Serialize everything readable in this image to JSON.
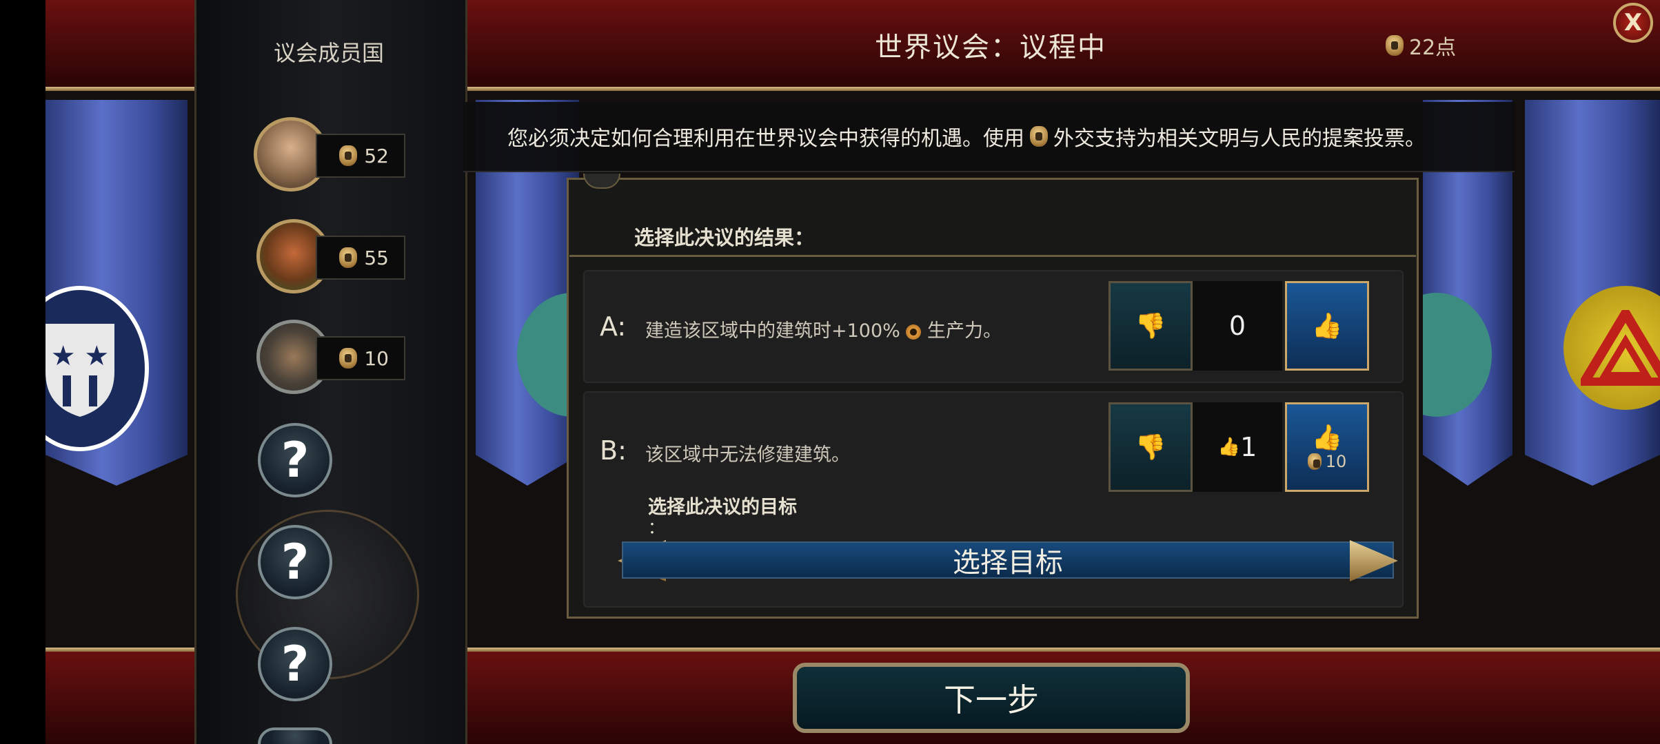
{
  "header": {
    "title": "世界议会：议程中",
    "points": "22点",
    "close_label": "X"
  },
  "instruction": {
    "prefix": "您必须决定如何合理利用在世界议会中获得的机遇。使用",
    "suffix": "外交支持为相关文明与人民的提案投票。"
  },
  "sidebar": {
    "title": "议会成员国",
    "members": [
      {
        "votes": "52"
      },
      {
        "votes": "55"
      },
      {
        "votes": "10"
      }
    ],
    "unknown_label": "?"
  },
  "resolution": {
    "outcome_heading": "选择此决议的结果：",
    "options": [
      {
        "letter": "A:",
        "text_before": "建造该区域中的建筑时+100%",
        "text_after": "生产力。",
        "count": "0"
      },
      {
        "letter": "B:",
        "text": "该区域中无法修建建筑。",
        "count": "1",
        "cost": "10"
      }
    ],
    "target_heading": "选择此决议的目标",
    "target_colon": "：",
    "target_select": "选择目标"
  },
  "footer": {
    "next_label": "下一步"
  },
  "colors": {
    "accent_gold": "#c9a86a",
    "upvote_blue": "#1a5796",
    "downvote_teal": "#163944",
    "header_red": "#6a1010"
  }
}
